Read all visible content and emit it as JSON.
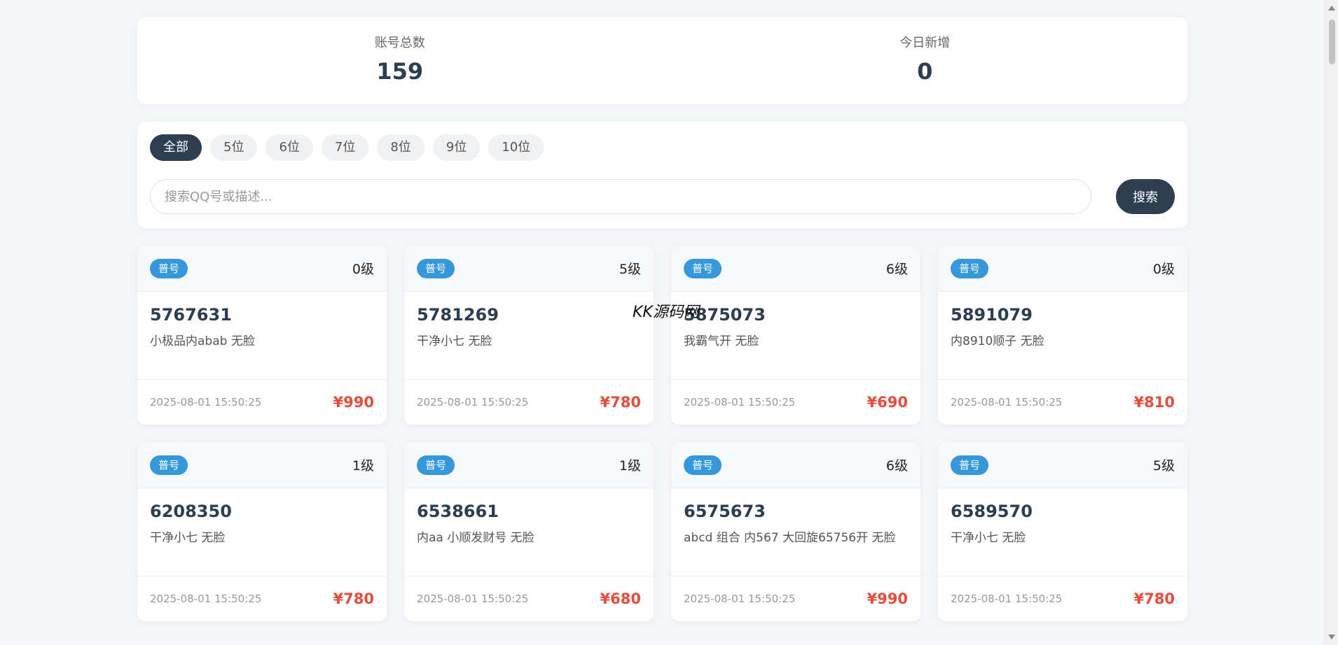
{
  "stats": {
    "total_label": "账号总数",
    "total_value": "159",
    "today_label": "今日新增",
    "today_value": "0"
  },
  "filters": [
    "全部",
    "5位",
    "6位",
    "7位",
    "8位",
    "9位",
    "10位"
  ],
  "active_filter": "全部",
  "search": {
    "placeholder": "搜索QQ号或描述...",
    "value": "",
    "button_label": "搜索"
  },
  "watermark": "KK源码网",
  "cards": [
    {
      "badge": "普号",
      "level": "0级",
      "qq": "5767631",
      "desc": "小极品内abab 无脸",
      "date": "2025-08-01 15:50:25",
      "price": "¥990"
    },
    {
      "badge": "普号",
      "level": "5级",
      "qq": "5781269",
      "desc": "干净小七 无脸",
      "date": "2025-08-01 15:50:25",
      "price": "¥780"
    },
    {
      "badge": "普号",
      "level": "6级",
      "qq": "5875073",
      "desc": "我霸气开 无脸",
      "date": "2025-08-01 15:50:25",
      "price": "¥690"
    },
    {
      "badge": "普号",
      "level": "0级",
      "qq": "5891079",
      "desc": "内8910顺子 无脸",
      "date": "2025-08-01 15:50:25",
      "price": "¥810"
    },
    {
      "badge": "普号",
      "level": "1级",
      "qq": "6208350",
      "desc": "干净小七 无脸",
      "date": "2025-08-01 15:50:25",
      "price": "¥780"
    },
    {
      "badge": "普号",
      "level": "1级",
      "qq": "6538661",
      "desc": "内aa 小顺发财号 无脸",
      "date": "2025-08-01 15:50:25",
      "price": "¥680"
    },
    {
      "badge": "普号",
      "level": "6级",
      "qq": "6575673",
      "desc": "abcd 组合 内567 大回旋65756开 无脸",
      "date": "2025-08-01 15:50:25",
      "price": "¥990"
    },
    {
      "badge": "普号",
      "level": "5级",
      "qq": "6589570",
      "desc": "干净小七 无脸",
      "date": "2025-08-01 15:50:25",
      "price": "¥780"
    }
  ]
}
